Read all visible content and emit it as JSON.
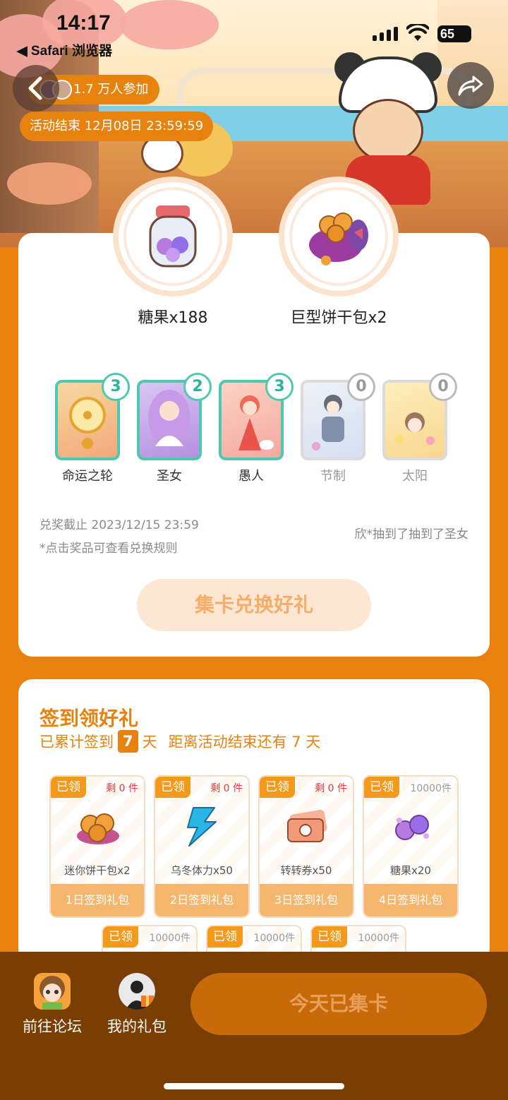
{
  "status_bar": {
    "time": "14:17",
    "back_app": "◀ Safari 浏览器",
    "battery": "65"
  },
  "header": {
    "participants": "1.7 万人参加",
    "end_time": "活动结束 12月08日 23:59:59",
    "back_icon": "chevron-left-icon",
    "share_icon": "share-arrow-icon"
  },
  "prizes": [
    {
      "label": "糖果x188",
      "icon": "candy-jar-icon"
    },
    {
      "label": "巨型饼干包x2",
      "icon": "cookie-box-icon"
    }
  ],
  "tarot_cards": [
    {
      "name": "命运之轮",
      "count": "3",
      "collected": true
    },
    {
      "name": "圣女",
      "count": "2",
      "collected": true
    },
    {
      "name": "愚人",
      "count": "3",
      "collected": true
    },
    {
      "name": "节制",
      "count": "0",
      "collected": false
    },
    {
      "name": "太阳",
      "count": "0",
      "collected": false
    }
  ],
  "exchange": {
    "deadline": "兑奖截止 2023/12/15 23:59",
    "note": "*点击奖品可查看兑换规则",
    "draw_news": "欣*抽到了抽到了圣女",
    "button": "集卡兑换好礼"
  },
  "signin": {
    "title": "签到领好礼",
    "prefix": "已累计签到",
    "days": "7",
    "days_unit": "天",
    "remaining": "距离活动结束还有 7 天",
    "gifts": [
      {
        "tag": "已领",
        "stock": "剩 0 件",
        "name": "迷你饼干包x2",
        "day": "1日签到礼包"
      },
      {
        "tag": "已领",
        "stock": "剩 0 件",
        "name": "乌冬体力x50",
        "day": "2日签到礼包"
      },
      {
        "tag": "已领",
        "stock": "剩 0 件",
        "name": "转转券x50",
        "day": "3日签到礼包"
      },
      {
        "tag": "已领",
        "stock": "10000件",
        "name": "糖果x20",
        "day": "4日签到礼包"
      }
    ],
    "gifts_row2": [
      {
        "tag": "已领",
        "stock": "10000件"
      },
      {
        "tag": "已领",
        "stock": "10000件"
      },
      {
        "tag": "已领",
        "stock": "10000件"
      }
    ]
  },
  "bottom_nav": {
    "forum": "前往论坛",
    "my_gifts": "我的礼包",
    "collect_button": "今天已集卡"
  },
  "colors": {
    "accent": "#e8820f",
    "bottom_bar": "#7a3e03",
    "tarot_border": "#4ec9b0"
  }
}
